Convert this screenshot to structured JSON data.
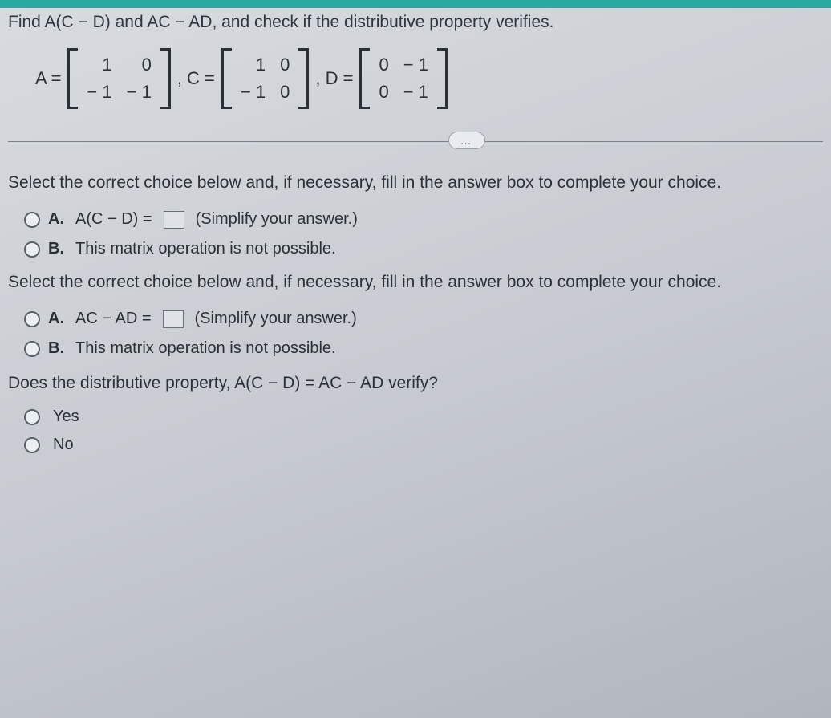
{
  "prompt": "Find A(C − D) and AC − AD, and check if the distributive property verifies.",
  "matrices": {
    "A": {
      "label": "A =",
      "cells": [
        "1",
        "0",
        "− 1",
        "− 1"
      ]
    },
    "C": {
      "label": ", C =",
      "cells": [
        "1",
        "0",
        "− 1",
        "0"
      ]
    },
    "D": {
      "label": ", D =",
      "cells": [
        "0",
        "− 1",
        "0",
        "− 1"
      ]
    }
  },
  "dots": "…",
  "instruction1": "Select the correct choice below and, if necessary, fill in the answer box to complete your choice.",
  "q1": {
    "A": {
      "letter": "A.",
      "expr": "A(C − D) =",
      "hint": "(Simplify your answer.)"
    },
    "B": {
      "letter": "B.",
      "text": "This matrix operation is not possible."
    }
  },
  "instruction2": "Select the correct choice below and, if necessary, fill in the answer box to complete your choice.",
  "q2": {
    "A": {
      "letter": "A.",
      "expr": "AC − AD =",
      "hint": "(Simplify your answer.)"
    },
    "B": {
      "letter": "B.",
      "text": "This matrix operation is not possible."
    }
  },
  "verify_q": "Does the distributive property, A(C − D) = AC − AD verify?",
  "yes": "Yes",
  "no": "No"
}
